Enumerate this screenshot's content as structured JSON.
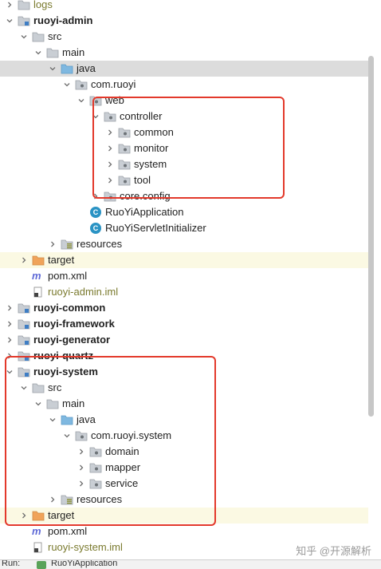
{
  "tree": [
    {
      "label": "logs",
      "expanded": false,
      "icon": "folder-icon",
      "style": "olive"
    },
    {
      "label": "ruoyi-admin",
      "expanded": true,
      "icon": "module-folder-icon",
      "style": "bold"
    },
    {
      "label": "src",
      "expanded": true,
      "icon": "folder-icon"
    },
    {
      "label": "main",
      "expanded": true,
      "icon": "folder-icon"
    },
    {
      "label": "java",
      "expanded": true,
      "icon": "source-root-folder-icon",
      "selected": true
    },
    {
      "label": "com.ruoyi",
      "expanded": true,
      "icon": "package-icon"
    },
    {
      "label": "web",
      "expanded": true,
      "icon": "package-icon"
    },
    {
      "label": "controller",
      "expanded": true,
      "icon": "package-icon"
    },
    {
      "label": "common",
      "expanded": false,
      "icon": "package-icon"
    },
    {
      "label": "monitor",
      "expanded": false,
      "icon": "package-icon"
    },
    {
      "label": "system",
      "expanded": false,
      "icon": "package-icon"
    },
    {
      "label": "tool",
      "expanded": false,
      "icon": "package-icon"
    },
    {
      "label": "core.config",
      "expanded": false,
      "icon": "package-icon"
    },
    {
      "label": "RuoYiApplication",
      "icon": "java-class-icon"
    },
    {
      "label": "RuoYiServletInitializer",
      "icon": "java-class-icon"
    },
    {
      "label": "resources",
      "expanded": false,
      "icon": "resources-folder-icon"
    },
    {
      "label": "target",
      "expanded": false,
      "icon": "excluded-folder-icon",
      "excluded": true
    },
    {
      "label": "pom.xml",
      "icon": "maven-file-icon"
    },
    {
      "label": "ruoyi-admin.iml",
      "icon": "iml-file-icon",
      "style": "olive"
    },
    {
      "label": "ruoyi-common",
      "expanded": false,
      "icon": "module-folder-icon",
      "style": "bold"
    },
    {
      "label": "ruoyi-framework",
      "expanded": false,
      "icon": "module-folder-icon",
      "style": "bold"
    },
    {
      "label": "ruoyi-generator",
      "expanded": false,
      "icon": "module-folder-icon",
      "style": "bold"
    },
    {
      "label": "ruoyi-quartz",
      "expanded": false,
      "icon": "module-folder-icon",
      "style": "bold"
    },
    {
      "label": "ruoyi-system",
      "expanded": true,
      "icon": "module-folder-icon",
      "style": "bold"
    },
    {
      "label": "src",
      "expanded": true,
      "icon": "folder-icon"
    },
    {
      "label": "main",
      "expanded": true,
      "icon": "folder-icon"
    },
    {
      "label": "java",
      "expanded": true,
      "icon": "source-root-folder-icon"
    },
    {
      "label": "com.ruoyi.system",
      "expanded": true,
      "icon": "package-icon"
    },
    {
      "label": "domain",
      "expanded": false,
      "icon": "package-icon"
    },
    {
      "label": "mapper",
      "expanded": false,
      "icon": "package-icon"
    },
    {
      "label": "service",
      "expanded": false,
      "icon": "package-icon"
    },
    {
      "label": "resources",
      "expanded": false,
      "icon": "resources-folder-icon"
    },
    {
      "label": "target",
      "expanded": false,
      "icon": "excluded-folder-icon",
      "excluded": true
    },
    {
      "label": "pom.xml",
      "icon": "maven-file-icon"
    },
    {
      "label": "ruoyi-system.iml",
      "icon": "iml-file-icon",
      "style": "olive"
    }
  ],
  "watermark": "知乎 @开源解析",
  "runbar": {
    "label": "Run:",
    "config": "RuoYiApplication"
  },
  "colors": {
    "folder": "#8fb3cf",
    "source_root": "#7fb8e0",
    "excluded": "#f0a35a",
    "highlight": "#e3392b"
  }
}
